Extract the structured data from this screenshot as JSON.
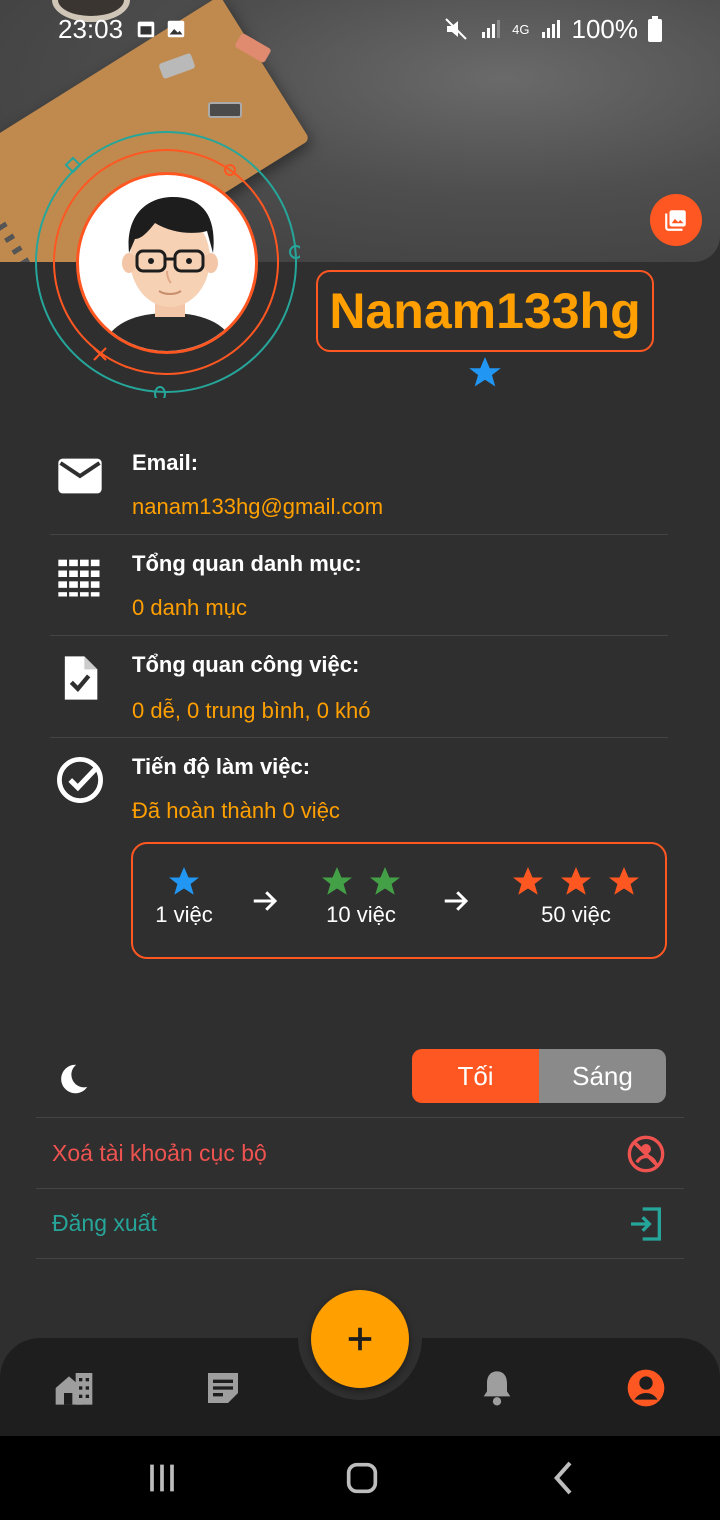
{
  "status_bar": {
    "time": "23:03",
    "battery": "100%",
    "network": "4G"
  },
  "profile": {
    "username": "Nanam133hg",
    "rank_stars": 1
  },
  "info": [
    {
      "label": "Email:",
      "value": "nanam133hg@gmail.com",
      "icon": "mail-icon"
    },
    {
      "label": "Tổng quan danh mục:",
      "value": "0 danh mục",
      "icon": "grid-icon"
    },
    {
      "label": "Tổng quan công việc:",
      "value": "0 dễ, 0 trung bình, 0 khó",
      "icon": "task-file-icon"
    },
    {
      "label": "Tiến độ làm việc:",
      "value": "Đã hoàn thành 0 việc",
      "icon": "check-circle-icon"
    }
  ],
  "ranks": [
    {
      "label": "1 việc",
      "stars": 1,
      "color": "#2196f3"
    },
    {
      "label": "10 việc",
      "stars": 2,
      "color": "#43a047"
    },
    {
      "label": "50 việc",
      "stars": 3,
      "color": "#ff5722"
    }
  ],
  "theme": {
    "dark_label": "Tối",
    "light_label": "Sáng",
    "selected": "dark"
  },
  "actions": {
    "delete_local": "Xoá tài khoản cục bộ",
    "logout": "Đăng xuất"
  },
  "colors": {
    "accent": "#ff5722",
    "highlight": "#ffa000",
    "danger": "#ef5350",
    "teal": "#26a69a",
    "background": "#2f2f2f"
  },
  "nav": {
    "items": [
      "home-icon",
      "notes-icon",
      "bell-icon",
      "profile-icon"
    ],
    "active": "profile-icon"
  }
}
